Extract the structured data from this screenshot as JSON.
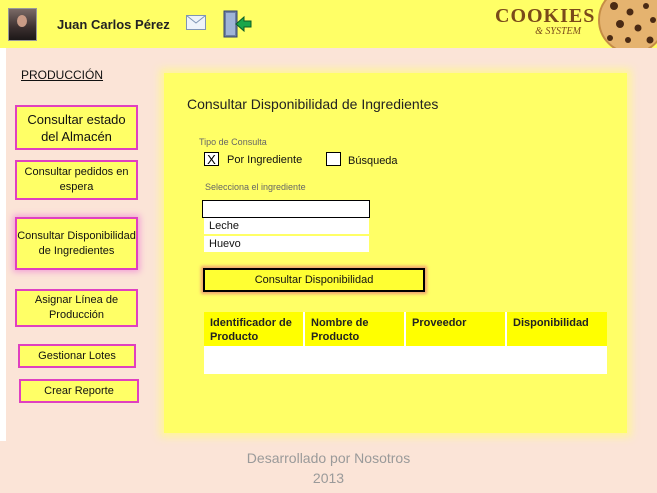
{
  "header": {
    "username": "Juan Carlos Pérez",
    "logo_title": "COOKIES",
    "logo_subtitle": "& SYSTEM"
  },
  "sidebar": {
    "section_title": "PRODUCCIÓN",
    "items": [
      {
        "label": "Consultar estado del Almacén"
      },
      {
        "label": "Consultar pedidos en espera"
      },
      {
        "label": "Consultar Disponibilidad de Ingredientes"
      },
      {
        "label": "Asignar Línea de Producción"
      },
      {
        "label": "Gestionar Lotes"
      },
      {
        "label": "Crear Reporte"
      }
    ]
  },
  "main": {
    "title": "Consultar Disponibilidad de Ingredientes",
    "query_type_label": "Tipo de Consulta",
    "option_ingredient": {
      "label": "Por Ingrediente",
      "mark": "X"
    },
    "option_search": {
      "label": "Búsqueda",
      "mark": ""
    },
    "select_label": "Selecciona el ingrediente",
    "search_value": "",
    "ingredients": [
      "Leche",
      "Huevo"
    ],
    "consult_button": "Consultar Disponibilidad",
    "table": {
      "headers": [
        "Identificador de Producto",
        "Nombre de Producto",
        "Proveedor",
        "Disponibilidad"
      ]
    }
  },
  "footer": {
    "line1": "Desarrollado por Nosotros",
    "line2": "2013"
  },
  "colors": {
    "header_bg": "#ffff66",
    "accent_border": "#e040c0",
    "page_bg": "#fbe4d7",
    "table_header": "#ffff00"
  }
}
